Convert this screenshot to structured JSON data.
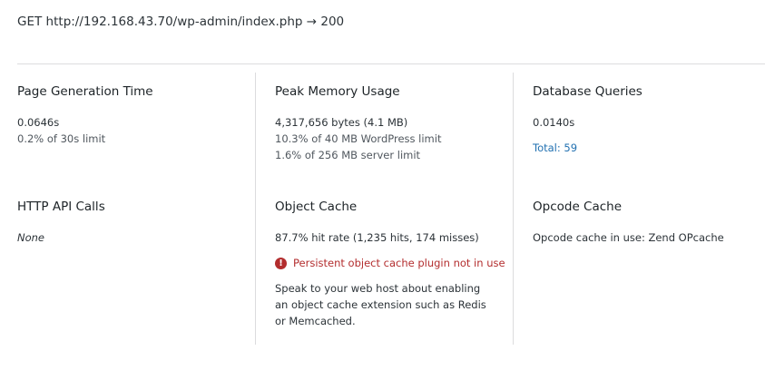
{
  "request": {
    "method": "GET",
    "url": "http://192.168.43.70/wp-admin/index.php",
    "arrow": "→",
    "status": "200"
  },
  "panels": {
    "page_generation": {
      "title": "Page Generation Time",
      "value": "0.0646s",
      "limit": "0.2% of 30s limit"
    },
    "peak_memory": {
      "title": "Peak Memory Usage",
      "value": "4,317,656 bytes (4.1 MB)",
      "wp_limit": "10.3% of 40 MB WordPress limit",
      "server_limit": "1.6% of 256 MB server limit"
    },
    "database_queries": {
      "title": "Database Queries",
      "value": "0.0140s",
      "total_link": "Total: 59"
    },
    "http_api_calls": {
      "title": "HTTP API Calls",
      "value": "None"
    },
    "object_cache": {
      "title": "Object Cache",
      "hit_rate": "87.7% hit rate (1,235 hits, 174 misses)",
      "warning": "Persistent object cache plugin not in use",
      "advice": "Speak to your web host about enabling an object cache extension such as Redis or Memcached."
    },
    "opcode_cache": {
      "title": "Opcode Cache",
      "value": "Opcode cache in use: Zend OPcache"
    }
  },
  "icons": {
    "warning": "exclamation-circle-icon"
  },
  "colors": {
    "link": "#2271b1",
    "warning": "#b32d2e",
    "divider": "#dcdcde"
  }
}
